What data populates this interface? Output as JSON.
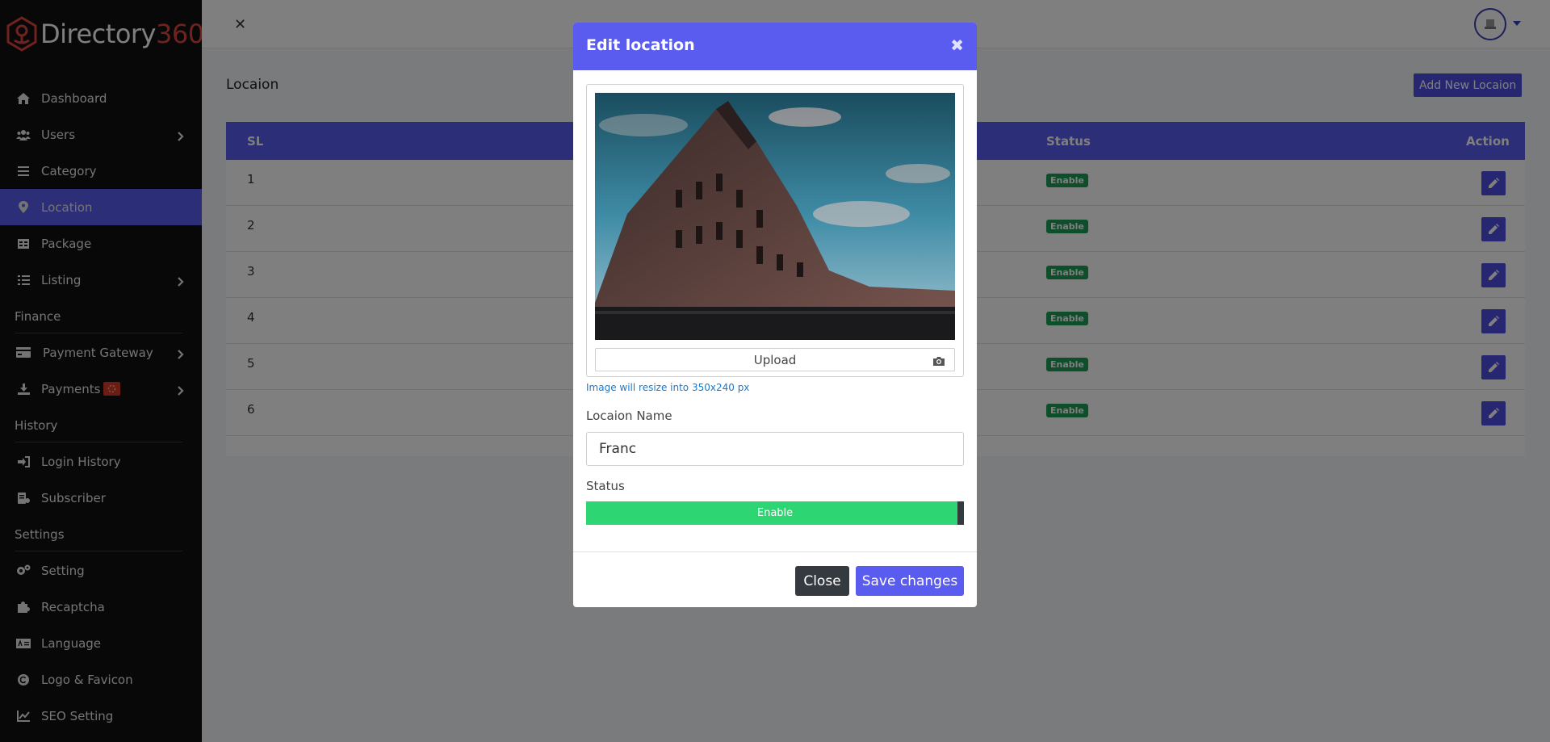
{
  "brand": {
    "name_part1": "Directory",
    "name_part2": "360"
  },
  "sidebar": {
    "items": [
      {
        "label": "Dashboard",
        "icon": "home-icon"
      },
      {
        "label": "Users",
        "icon": "users-icon"
      },
      {
        "label": "Category",
        "icon": "list-icon"
      },
      {
        "label": "Location",
        "icon": "map-marker-icon"
      },
      {
        "label": "Package",
        "icon": "table-icon"
      },
      {
        "label": "Listing",
        "icon": "list-ul-icon"
      },
      {
        "label": "Finance"
      },
      {
        "label": "Payment Gateway",
        "icon": "credit-card-icon"
      },
      {
        "label": "Payments",
        "icon": "download-icon"
      },
      {
        "label": "History"
      },
      {
        "label": "Login History",
        "icon": "sign-in-icon"
      },
      {
        "label": "Subscriber",
        "icon": "subscriber-icon"
      },
      {
        "label": "Settings"
      },
      {
        "label": "Setting",
        "icon": "cogs-icon"
      },
      {
        "label": "Recaptcha",
        "icon": "puzzle-icon"
      },
      {
        "label": "Language",
        "icon": "language-icon"
      },
      {
        "label": "Logo & Favicon",
        "icon": "copyright-icon"
      },
      {
        "label": "SEO Setting",
        "icon": "chart-line-icon"
      }
    ]
  },
  "page": {
    "title": "Locaion",
    "add_button": "Add New Locaion"
  },
  "table": {
    "headers": {
      "sl": "SL",
      "status": "Status",
      "action": "Action"
    },
    "rows": [
      {
        "sl": "1",
        "status": "Enable"
      },
      {
        "sl": "2",
        "status": "Enable"
      },
      {
        "sl": "3",
        "status": "Enable"
      },
      {
        "sl": "4",
        "status": "Enable"
      },
      {
        "sl": "5",
        "status": "Enable"
      },
      {
        "sl": "6",
        "status": "Enable"
      }
    ]
  },
  "modal": {
    "title": "Edit location",
    "upload_label": "Upload",
    "image_hint": "Image will resize into 350x240 px",
    "name_label": "Locaion Name",
    "name_value": "Franc",
    "status_label": "Status",
    "status_value": "Enable",
    "close_button": "Close",
    "save_button": "Save changes"
  },
  "colors": {
    "accent": "#5a5cf0",
    "sidebar_bg": "#111111",
    "success": "#1f9d55",
    "toggle_on": "#2ed573",
    "dark_button": "#343a40"
  }
}
